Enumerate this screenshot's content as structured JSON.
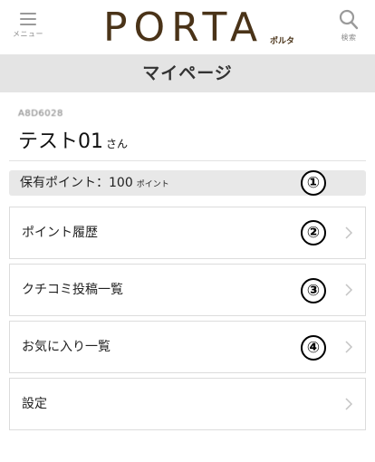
{
  "header": {
    "menu_label": "メニュー",
    "logo_text": "PORTA",
    "logo_sub": "ポルタ",
    "search_label": "検索"
  },
  "page": {
    "title": "マイページ"
  },
  "user": {
    "id": "A8D6028",
    "name": "テスト01",
    "honorific": "さん"
  },
  "points": {
    "label": "保有ポイント：100",
    "unit": "ポイント",
    "value": 100
  },
  "menu": {
    "items": [
      {
        "label": "ポイント履歴"
      },
      {
        "label": "クチコミ投稿一覧"
      },
      {
        "label": "お気に入り一覧"
      },
      {
        "label": "設定"
      }
    ]
  },
  "callouts": [
    "①",
    "②",
    "③",
    "④"
  ],
  "colors": {
    "logo": "#4a3318",
    "page_bar": "#e4e4e4",
    "points_bar": "#e8e8e8",
    "border": "#dcdcdc"
  }
}
